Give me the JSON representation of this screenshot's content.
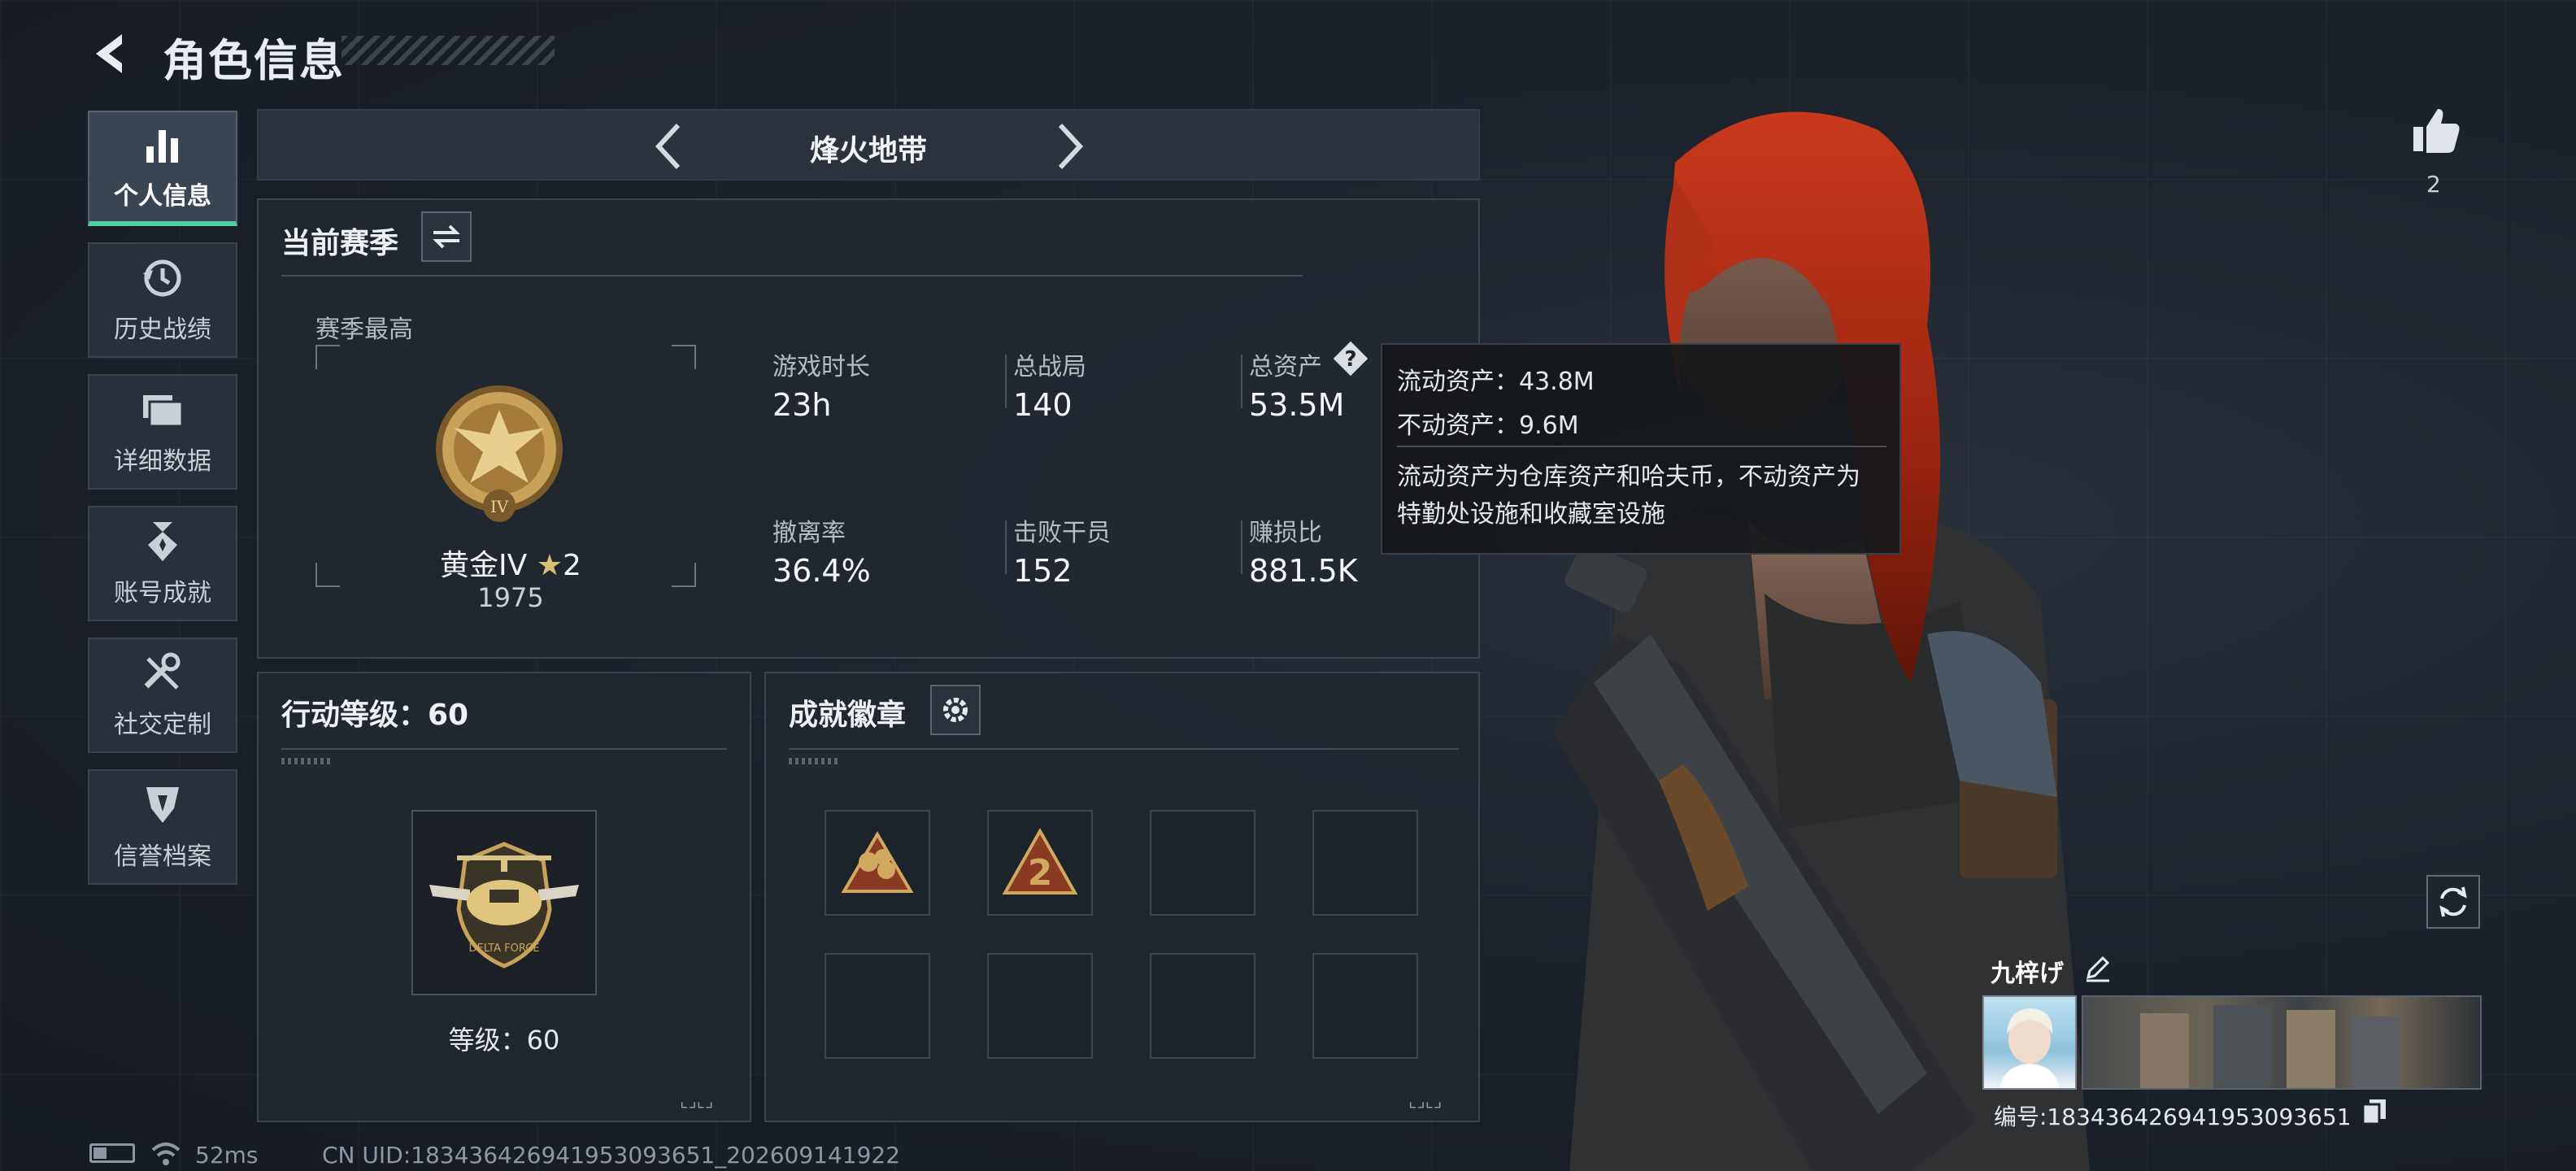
{
  "header": {
    "title": "角色信息"
  },
  "nav": {
    "items": [
      {
        "label": "个人信息",
        "icon": "bar-chart-icon",
        "active": true
      },
      {
        "label": "历史战绩",
        "icon": "history-clock-icon",
        "active": false
      },
      {
        "label": "详细数据",
        "icon": "folders-icon",
        "active": false
      },
      {
        "label": "账号成就",
        "icon": "medal-icon",
        "active": false
      },
      {
        "label": "社交定制",
        "icon": "tools-icon",
        "active": false
      },
      {
        "label": "信誉档案",
        "icon": "shield-icon",
        "active": false
      }
    ]
  },
  "mode": {
    "name": "烽火地带"
  },
  "season": {
    "title": "当前赛季",
    "best_label": "赛季最高",
    "rank_text": "黄金IV",
    "rank_stars": "2",
    "rank_score": "1975",
    "rank_badge_numeral": "IV",
    "stats": [
      {
        "label": "游戏时长",
        "value": "23h"
      },
      {
        "label": "总战局",
        "value": "140"
      },
      {
        "label": "总资产",
        "value": "53.5M"
      },
      {
        "label": "撤离率",
        "value": "36.4%"
      },
      {
        "label": "击败干员",
        "value": "152"
      },
      {
        "label": "赚损比",
        "value": "881.5K"
      }
    ]
  },
  "tooltip": {
    "liquid": "流动资产：43.8M",
    "fixed": "不动资产：9.6M",
    "note": "流动资产为仓库资产和哈夫币，不动资产为特勤处设施和收藏室设施"
  },
  "action_level": {
    "title": "行动等级：60",
    "level_text": "等级：60",
    "badge_text": "DELTA FORCE"
  },
  "achievements": {
    "title": "成就徽章",
    "slots_filled": 2,
    "slots_total": 8,
    "badge2_text": "2"
  },
  "status": {
    "ping": "52ms",
    "uid": "CN UID:183436426941953093651_202609141922"
  },
  "profile": {
    "likes": "2",
    "name": "九梓げ",
    "id": "编号:183436426941953093651"
  },
  "colors": {
    "accent": "#4fd0a0",
    "gold": "#c9a25a",
    "panel": "#212830",
    "tooltip": "#16181b"
  }
}
